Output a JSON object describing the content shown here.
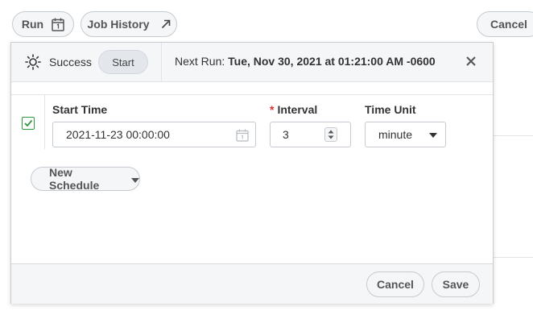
{
  "toolbar": {
    "run_label": "Run",
    "job_history_label": "Job History",
    "cancel_label": "Cancel"
  },
  "panel": {
    "status_label": "Success",
    "start_label": "Start",
    "next_run_prefix": "Next Run:",
    "next_run_value": "Tue, Nov 30, 2021 at 01:21:00 AM -0600"
  },
  "schedule": {
    "enabled": true,
    "start_time_label": "Start Time",
    "start_time_value": "2021-11-23 00:00:00",
    "interval_required_mark": "*",
    "interval_label": "Interval",
    "interval_value": "3",
    "time_unit_label": "Time Unit",
    "time_unit_value": "minute"
  },
  "actions": {
    "new_schedule_label": "New Schedule",
    "cancel_label": "Cancel",
    "save_label": "Save"
  },
  "colors": {
    "check_green": "#2e9a3b",
    "required_red": "#d0342c",
    "panel_bg": "#f4f6f8"
  },
  "icons": {
    "run": "calendar-icon",
    "job_history": "external-arrow-icon",
    "status": "sun-status-icon",
    "close": "close-icon"
  }
}
